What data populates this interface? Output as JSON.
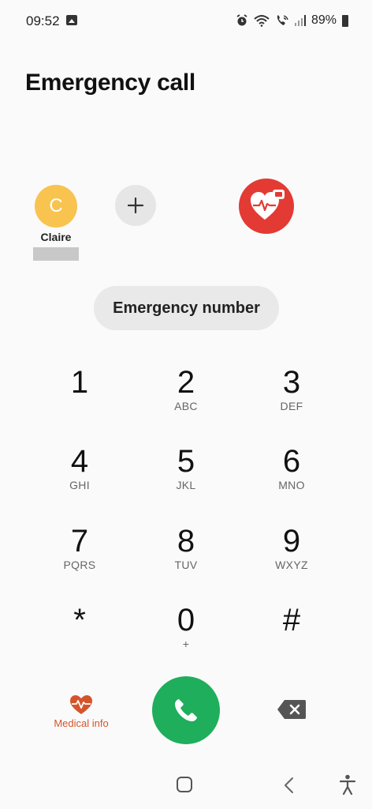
{
  "status_bar": {
    "time": "09:52",
    "battery": "89%",
    "icons": [
      "gallery-icon",
      "alarm-icon",
      "wifi-icon",
      "wifi-call-icon",
      "signal-icon",
      "battery-icon"
    ]
  },
  "title": "Emergency call",
  "contacts": [
    {
      "initial": "C",
      "name": "Claire",
      "avatar_color": "#f8c34f"
    }
  ],
  "medical_badge_color": "#e33a34",
  "emergency_number_label": "Emergency number",
  "keypad": {
    "keys": [
      {
        "digit": "1",
        "letters": ""
      },
      {
        "digit": "2",
        "letters": "ABC"
      },
      {
        "digit": "3",
        "letters": "DEF"
      },
      {
        "digit": "4",
        "letters": "GHI"
      },
      {
        "digit": "5",
        "letters": "JKL"
      },
      {
        "digit": "6",
        "letters": "MNO"
      },
      {
        "digit": "7",
        "letters": "PQRS"
      },
      {
        "digit": "8",
        "letters": "TUV"
      },
      {
        "digit": "9",
        "letters": "WXYZ"
      },
      {
        "digit": "*",
        "letters": ""
      },
      {
        "digit": "0",
        "letters": "+"
      },
      {
        "digit": "#",
        "letters": ""
      }
    ]
  },
  "actions": {
    "medical_info_label": "Medical info",
    "call_color": "#1fae5b",
    "medical_color": "#d4552b"
  },
  "nav": {
    "icons": [
      "home-icon",
      "back-icon",
      "accessibility-icon"
    ]
  }
}
